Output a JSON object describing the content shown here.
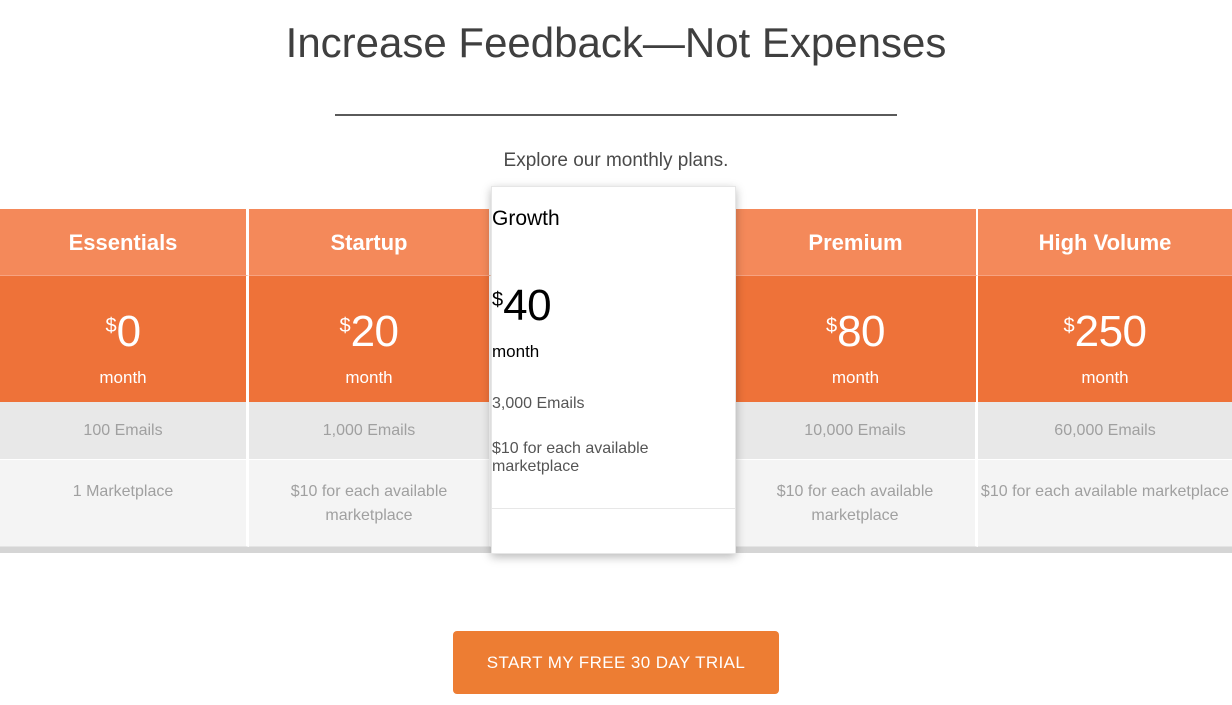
{
  "header": {
    "title": "Increase Feedback—Not Expenses",
    "subtitle": "Explore our monthly plans."
  },
  "colors": {
    "header_orange": "#f4895a",
    "price_orange": "#ee7239",
    "cta_orange": "#ed7d33",
    "row_emails_bg": "#e8e8e8",
    "row_market_bg": "#f4f4f4",
    "row_text": "#a0a0a0",
    "featured_row_text": "#555555",
    "title_text": "#3f3f3f"
  },
  "plans": [
    {
      "name": "Essentials",
      "currency": "$",
      "amount": "0",
      "period": "month",
      "emails": "100 Emails",
      "marketplace": "1 Marketplace",
      "featured": false
    },
    {
      "name": "Startup",
      "currency": "$",
      "amount": "20",
      "period": "month",
      "emails": "1,000 Emails",
      "marketplace": "$10 for each available marketplace",
      "featured": false
    },
    {
      "name": "Growth",
      "currency": "$",
      "amount": "40",
      "period": "month",
      "emails": "3,000 Emails",
      "marketplace": "$10 for each available marketplace",
      "featured": true
    },
    {
      "name": "Premium",
      "currency": "$",
      "amount": "80",
      "period": "month",
      "emails": "10,000 Emails",
      "marketplace": "$10 for each available marketplace",
      "featured": false
    },
    {
      "name": "High Volume",
      "currency": "$",
      "amount": "250",
      "period": "month",
      "emails": "60,000 Emails",
      "marketplace": "$10 for each available marketplace",
      "featured": false
    }
  ],
  "cta": {
    "label": "START MY FREE 30 DAY TRIAL"
  }
}
